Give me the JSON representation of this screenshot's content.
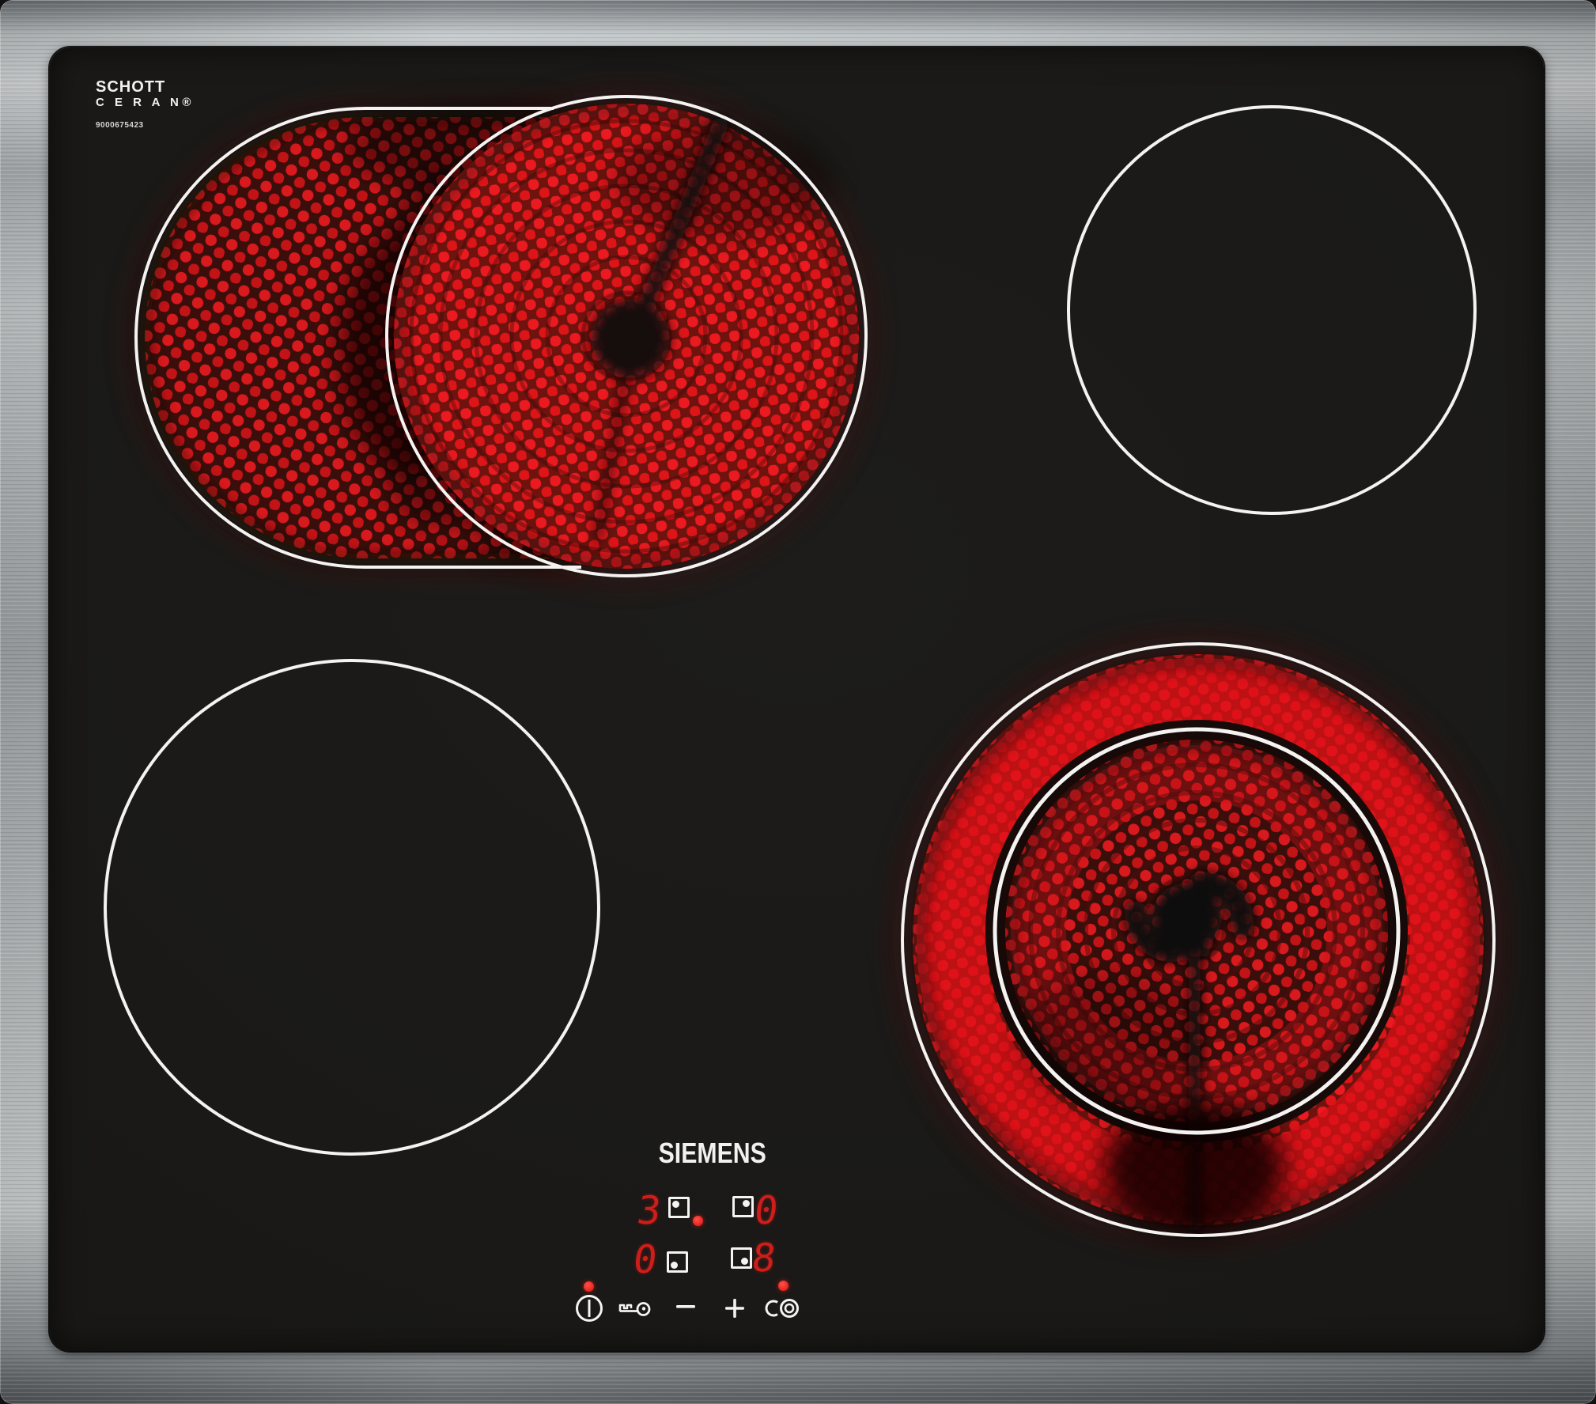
{
  "branding": {
    "glass_logo_line1": "SCHOTT",
    "glass_logo_line2": "C E R A N®",
    "model_number": "9000675423",
    "brand": "SIEMENS"
  },
  "display": {
    "zones": [
      {
        "zone": "rear-left",
        "level": "3",
        "indicator_dot_corner": "top-left",
        "status_led": true
      },
      {
        "zone": "rear-right",
        "level": "0",
        "indicator_dot_corner": "top-right",
        "status_led": false
      },
      {
        "zone": "front-left",
        "level": "0",
        "indicator_dot_corner": "bottom-left",
        "status_led": false
      },
      {
        "zone": "front-right",
        "level": "8",
        "indicator_dot_corner": "bottom-right",
        "status_led": true
      }
    ]
  },
  "controls": {
    "power": {
      "icon": "power-icon",
      "led_on": true
    },
    "child_lock": {
      "icon": "key-icon",
      "led_on": false
    },
    "decrease": {
      "icon": "minus-icon",
      "led_on": false
    },
    "increase": {
      "icon": "plus-icon",
      "led_on": false
    },
    "dual_zone": {
      "icon": "dual-zone-icon",
      "led_on": true
    }
  },
  "burners": [
    {
      "zone": "rear-left",
      "type": "extendable-oval",
      "state": "on"
    },
    {
      "zone": "rear-right",
      "type": "single",
      "state": "off"
    },
    {
      "zone": "front-left",
      "type": "single",
      "state": "off"
    },
    {
      "zone": "front-right",
      "type": "dual-circuit",
      "state": "on"
    }
  ],
  "theme": {
    "steel-light": "#d7dbdc",
    "steel-dark": "#6c7174",
    "glass-bg": "#1b1a18",
    "outline-white": "#f4f3f1",
    "glow-bright": "#e8181d",
    "glow-deep": "#6e120d",
    "led-red": "#e42320",
    "digit-red": "#cd1e1a",
    "text-white": "#f2f1ef"
  }
}
